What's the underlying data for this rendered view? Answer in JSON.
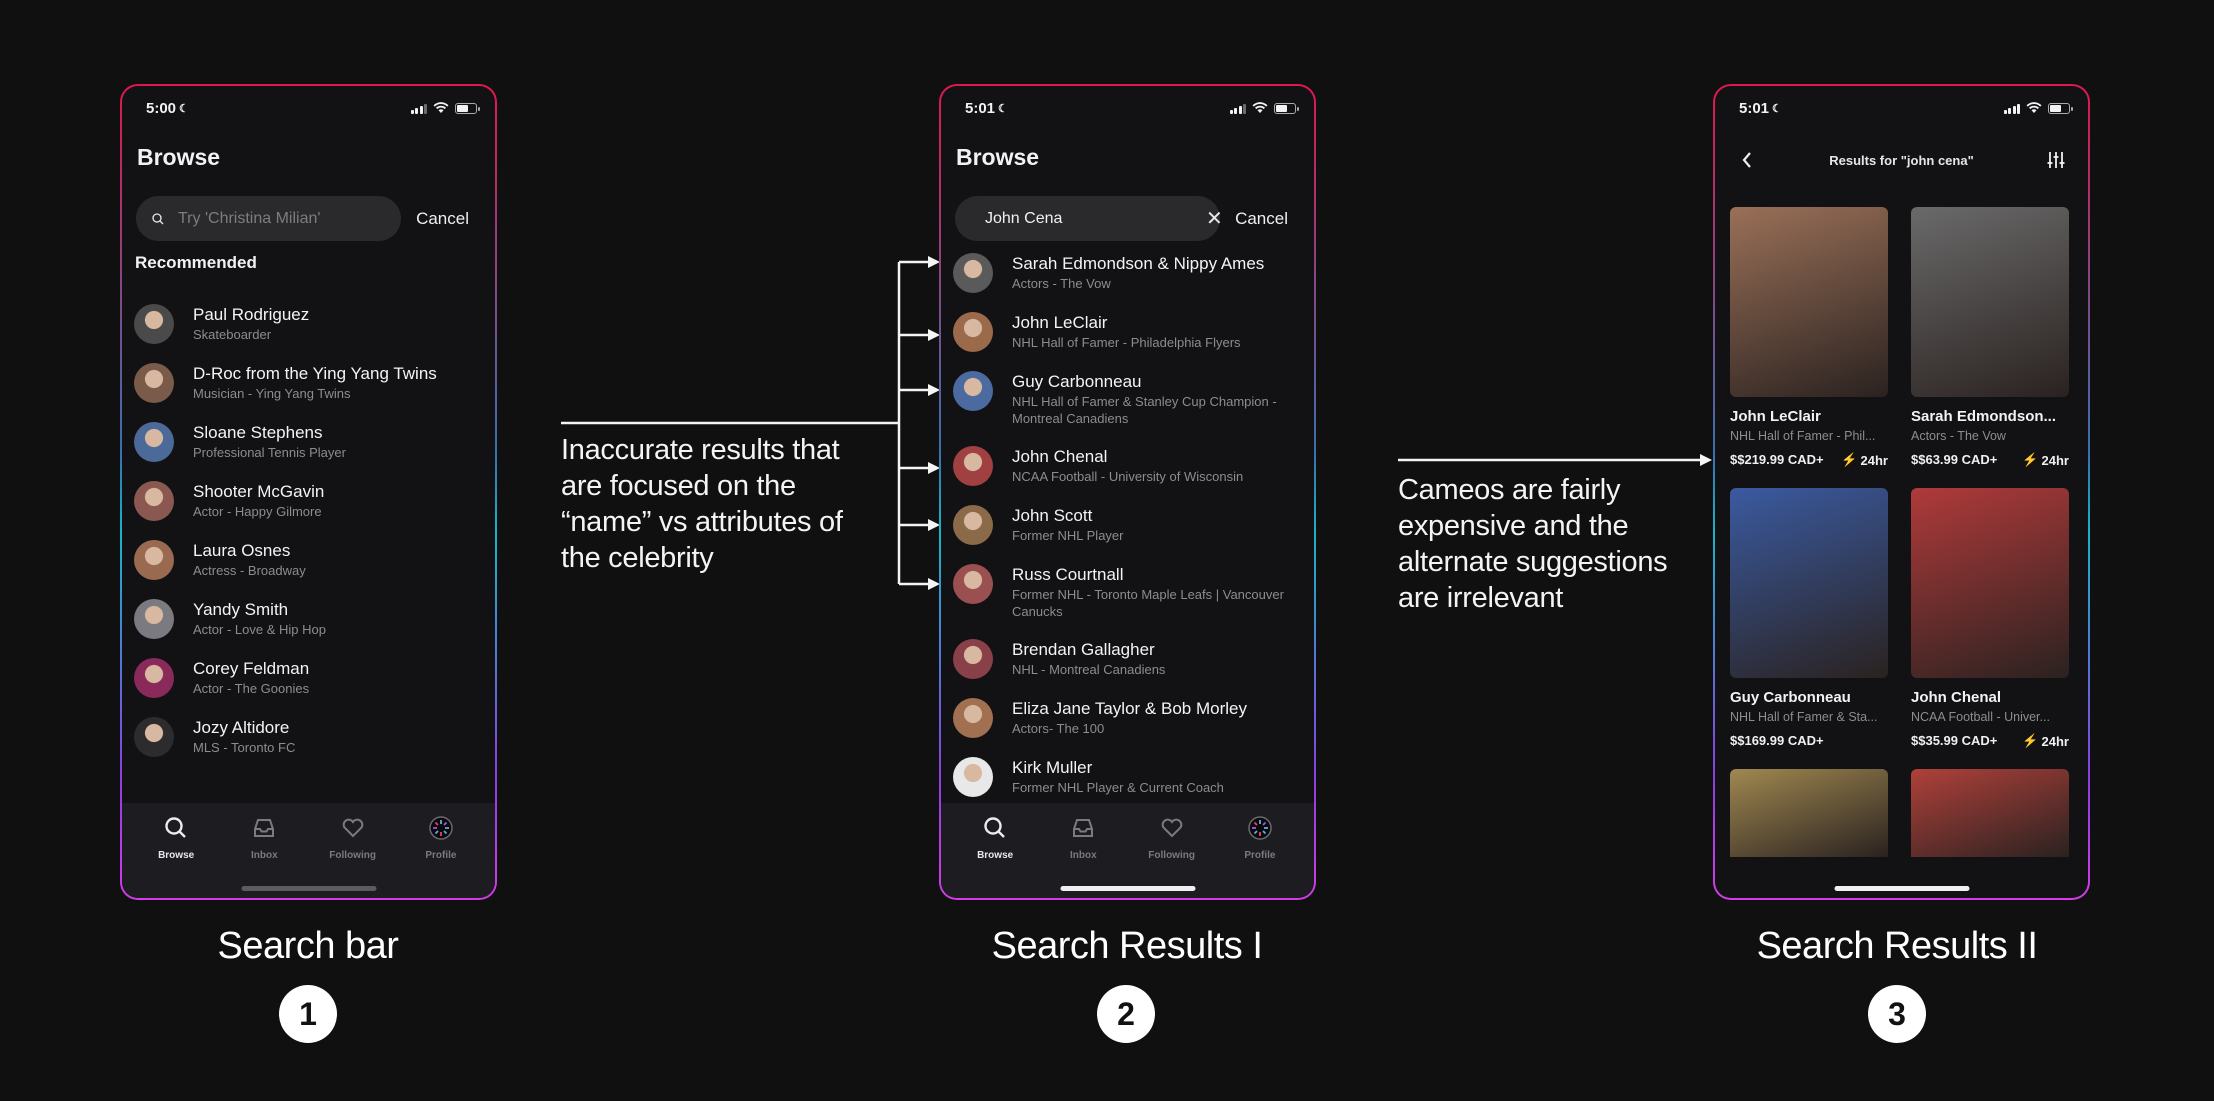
{
  "colors": {
    "background": "#101010",
    "phone_bg": "#121113",
    "search_bg": "#2a292c",
    "subtext": "#8d8c90",
    "lightning": "#f2c230",
    "frame_gradient": [
      "#e0174d",
      "#17b4c8",
      "#d43ce8"
    ]
  },
  "screens": [
    {
      "caption": "Search bar",
      "step": "1",
      "status_time": "5:00",
      "title": "Browse",
      "search": {
        "value": "",
        "placeholder": "Try 'Christina Milian'",
        "cancel": "Cancel"
      },
      "section_title": "Recommended",
      "items": [
        {
          "name": "Paul Rodriguez",
          "sub": "Skateboarder",
          "avatar_color": "#4a4a4a"
        },
        {
          "name": "D-Roc from the Ying Yang Twins",
          "sub": "Musician - Ying Yang Twins",
          "avatar_color": "#7a5a48"
        },
        {
          "name": "Sloane Stephens",
          "sub": "Professional Tennis Player",
          "avatar_color": "#4b6a9a"
        },
        {
          "name": "Shooter McGavin",
          "sub": "Actor - Happy Gilmore",
          "avatar_color": "#8a5850"
        },
        {
          "name": "Laura Osnes",
          "sub": "Actress - Broadway",
          "avatar_color": "#9a6a50"
        },
        {
          "name": "Yandy Smith",
          "sub": "Actor - Love & Hip Hop",
          "avatar_color": "#7a7a80"
        },
        {
          "name": "Corey Feldman",
          "sub": "Actor - The Goonies",
          "avatar_color": "#8a2a5a"
        },
        {
          "name": "Jozy Altidore",
          "sub": "MLS - Toronto FC",
          "avatar_color": "#2c2c2e"
        }
      ]
    },
    {
      "caption": "Search Results I",
      "step": "2",
      "status_time": "5:01",
      "title": "Browse",
      "search": {
        "value": "John Cena",
        "placeholder": "",
        "cancel": "Cancel"
      },
      "items": [
        {
          "name": "Sarah Edmondson & Nippy Ames",
          "sub": "Actors - The Vow",
          "avatar_color": "#5a5a5a"
        },
        {
          "name": "John LeClair",
          "sub": "NHL Hall of Famer - Philadelphia Flyers",
          "avatar_color": "#9a6a4a"
        },
        {
          "name": "Guy Carbonneau",
          "sub": "NHL Hall of Famer & Stanley Cup Champion - Montreal Canadiens",
          "avatar_color": "#4a6aa0"
        },
        {
          "name": "John Chenal",
          "sub": "NCAA Football - University of Wisconsin",
          "avatar_color": "#a04040"
        },
        {
          "name": "John Scott",
          "sub": "Former NHL Player",
          "avatar_color": "#8a6a48"
        },
        {
          "name": "Russ Courtnall",
          "sub": "Former NHL - Toronto Maple Leafs | Vancouver Canucks",
          "avatar_color": "#9a5050"
        },
        {
          "name": "Brendan Gallagher",
          "sub": "NHL - Montreal Canadiens",
          "avatar_color": "#8a4048"
        },
        {
          "name": "Eliza Jane Taylor & Bob Morley",
          "sub": "Actors- The 100",
          "avatar_color": "#a07050"
        },
        {
          "name": "Kirk Muller",
          "sub": "Former NHL Player & Current Coach",
          "avatar_color": "#e8e8e8"
        }
      ]
    },
    {
      "caption": "Search Results II",
      "step": "3",
      "status_time": "5:01",
      "header_title": "Results for \"john cena\"",
      "cards": [
        {
          "name": "John LeClair",
          "sub": "NHL Hall of Famer - Phil...",
          "price": "$$219.99 CAD+",
          "fast": "24hr",
          "img_color": "#9a7058"
        },
        {
          "name": "Sarah Edmondson...",
          "sub": "Actors - The Vow",
          "price": "$$63.99 CAD+",
          "fast": "24hr",
          "img_color": "#6a6a6a"
        },
        {
          "name": "Guy Carbonneau",
          "sub": "NHL Hall of Famer & Sta...",
          "price": "$$169.99 CAD+",
          "fast": "",
          "img_color": "#3a5aa0"
        },
        {
          "name": "John Chenal",
          "sub": "NCAA Football - Univer...",
          "price": "$$35.99 CAD+",
          "fast": "24hr",
          "img_color": "#b03a3a"
        },
        {
          "img_color": "#a08850"
        },
        {
          "img_color": "#b0403a"
        }
      ]
    }
  ],
  "tab_bar": [
    {
      "label": "Browse",
      "icon": "search-icon",
      "active": true
    },
    {
      "label": "Inbox",
      "icon": "inbox-icon",
      "active": false
    },
    {
      "label": "Following",
      "icon": "heart-icon",
      "active": false
    },
    {
      "label": "Profile",
      "icon": "profile-icon",
      "active": false
    }
  ],
  "annotations": [
    "Inaccurate results that are focused on the “name” vs attributes of the celebrity",
    "Cameos are fairly expensive and the alternate suggestions are irrelevant"
  ]
}
